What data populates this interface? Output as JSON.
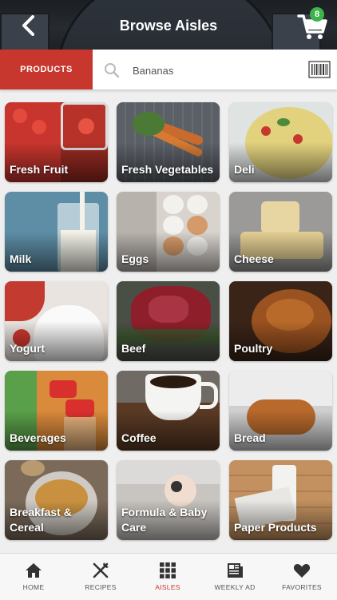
{
  "header": {
    "title": "Browse Aisles",
    "cart_count": "8"
  },
  "search": {
    "tab_label": "PRODUCTS",
    "placeholder": "Bananas"
  },
  "aisles": [
    "Fresh Fruit",
    "Fresh Vegetables",
    "Deli",
    "Milk",
    "Eggs",
    "Cheese",
    "Yogurt",
    "Beef",
    "Poultry",
    "Beverages",
    "Coffee",
    "Bread",
    "Breakfast & Cereal",
    "Formula & Baby Care",
    "Paper Products"
  ],
  "nav": {
    "items": [
      {
        "label": "HOME",
        "icon": "home-icon"
      },
      {
        "label": "RECIPES",
        "icon": "fork-knife-icon"
      },
      {
        "label": "AISLES",
        "icon": "grid-icon"
      },
      {
        "label": "WEEKLY AD",
        "icon": "newspaper-icon"
      },
      {
        "label": "FAVORITES",
        "icon": "heart-icon"
      }
    ],
    "active": "AISLES"
  },
  "colors": {
    "accent": "#c8372d",
    "badge": "#3cb44a"
  }
}
